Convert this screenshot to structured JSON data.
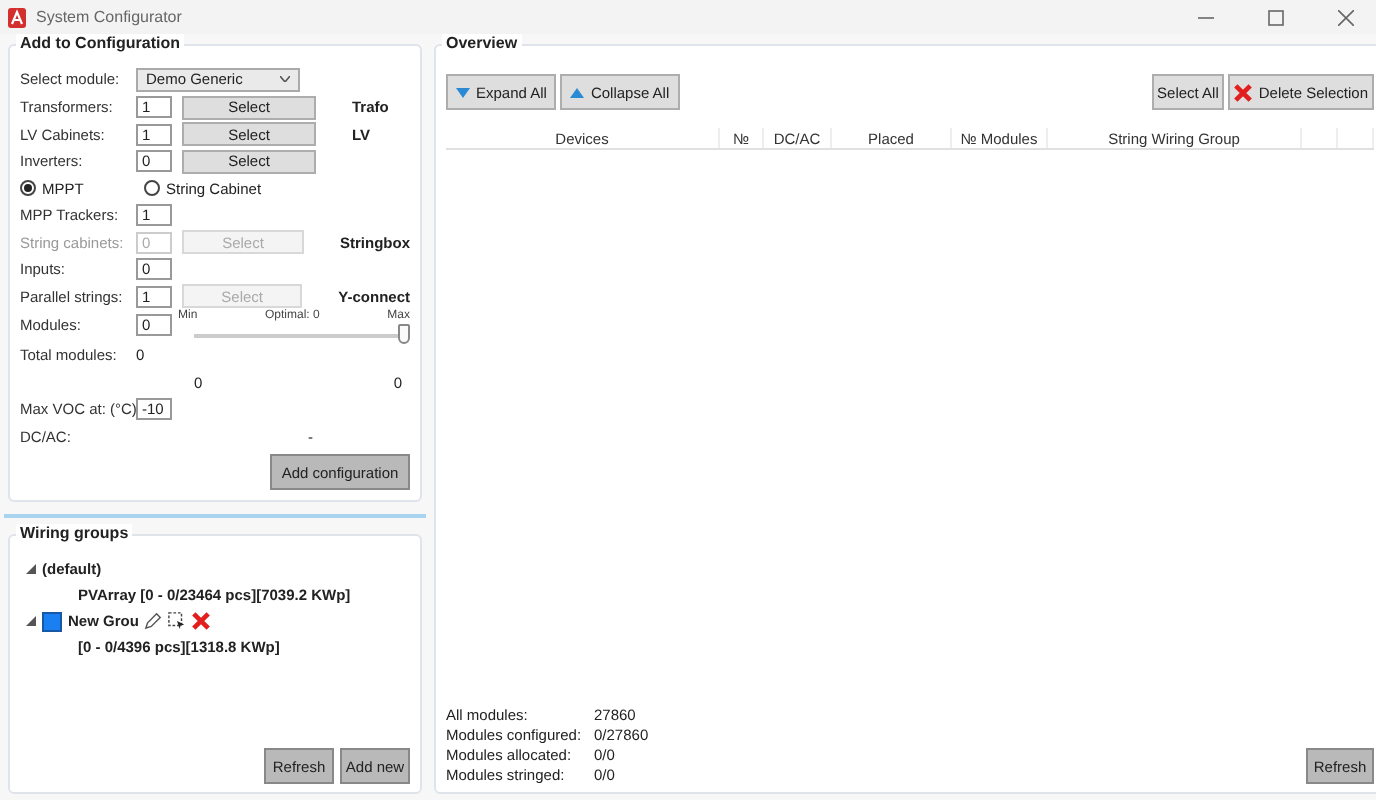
{
  "window": {
    "title": "System Configurator"
  },
  "configuration": {
    "title": "Add to Configuration",
    "rows": [
      {
        "kind": "select",
        "label": "Select module:",
        "value": "Demo Generic"
      },
      {
        "kind": "count",
        "label": "Transformers:",
        "value": "1",
        "disabled": false,
        "button": {
          "label": "Select",
          "disabled": false
        },
        "tag": "Trafo"
      },
      {
        "kind": "count",
        "label": "LV Cabinets:",
        "value": "1",
        "disabled": false,
        "button": {
          "label": "Select",
          "disabled": false
        },
        "tag": "LV"
      },
      {
        "kind": "count",
        "label": "Inverters:",
        "value": "0",
        "disabled": false,
        "button": {
          "label": "Select",
          "disabled": false
        }
      },
      {
        "kind": "radio",
        "options": [
          {
            "label": "MPPT",
            "selected": true
          },
          {
            "label": "String Cabinet",
            "selected": false
          }
        ]
      },
      {
        "kind": "count",
        "label": "MPP Trackers:",
        "value": "1",
        "disabled": false
      },
      {
        "kind": "count",
        "label": "String cabinets:",
        "value": "0",
        "disabled": true,
        "button": {
          "label": "Select",
          "disabled": true
        },
        "tag": "Stringbox"
      },
      {
        "kind": "count",
        "label": "Inputs:",
        "value": "0",
        "disabled": false
      },
      {
        "kind": "count",
        "label": "Parallel strings:",
        "value": "1",
        "disabled": false,
        "button": {
          "label": "Select",
          "disabled": true
        },
        "tag": "Y-connect"
      },
      {
        "kind": "modules",
        "label": "Modules:",
        "value": "0",
        "min": "Min",
        "optimal": "Optimal: 0",
        "max": "Max",
        "level": 1
      },
      {
        "kind": "stat",
        "label": "Total modules:",
        "value": "0"
      },
      {
        "kind": "range",
        "values": [
          "0",
          "0"
        ]
      },
      {
        "kind": "count",
        "label": "Max VOC at: (°C)",
        "value": "-10",
        "disabled": false
      },
      {
        "kind": "result",
        "label": "DC/AC:",
        "value": "-"
      }
    ],
    "add_button": "Add configuration"
  },
  "wiring_groups": {
    "title": "Wiring groups",
    "tree": [
      {
        "label": "(default)",
        "children": [
          {
            "label": "PVArray [0 - 0/23464 pcs][7039.2 KWp]"
          }
        ]
      },
      {
        "label": "New Grou",
        "color": "#1a7ff0",
        "children": [
          {
            "label": "[0 - 0/4396 pcs][1318.8 KWp]"
          }
        ]
      }
    ],
    "buttons": [
      "Refresh",
      "Add new"
    ]
  },
  "overview": {
    "title": "Overview",
    "left_buttons": [
      "Expand All",
      "Collapse All"
    ],
    "right_buttons": [
      "Select All",
      "Delete Selection"
    ],
    "columns": [
      "Devices",
      "№",
      "DC/AC",
      "Placed",
      "№ Modules",
      "String Wiring Group"
    ],
    "stats": [
      {
        "label": "All modules:",
        "value": "27860"
      },
      {
        "label": "Modules configured:",
        "value": "0/27860"
      },
      {
        "label": "Modules allocated:",
        "value": "0/0"
      },
      {
        "label": "Modules stringed:",
        "value": "0/0"
      }
    ],
    "refresh": "Refresh"
  }
}
